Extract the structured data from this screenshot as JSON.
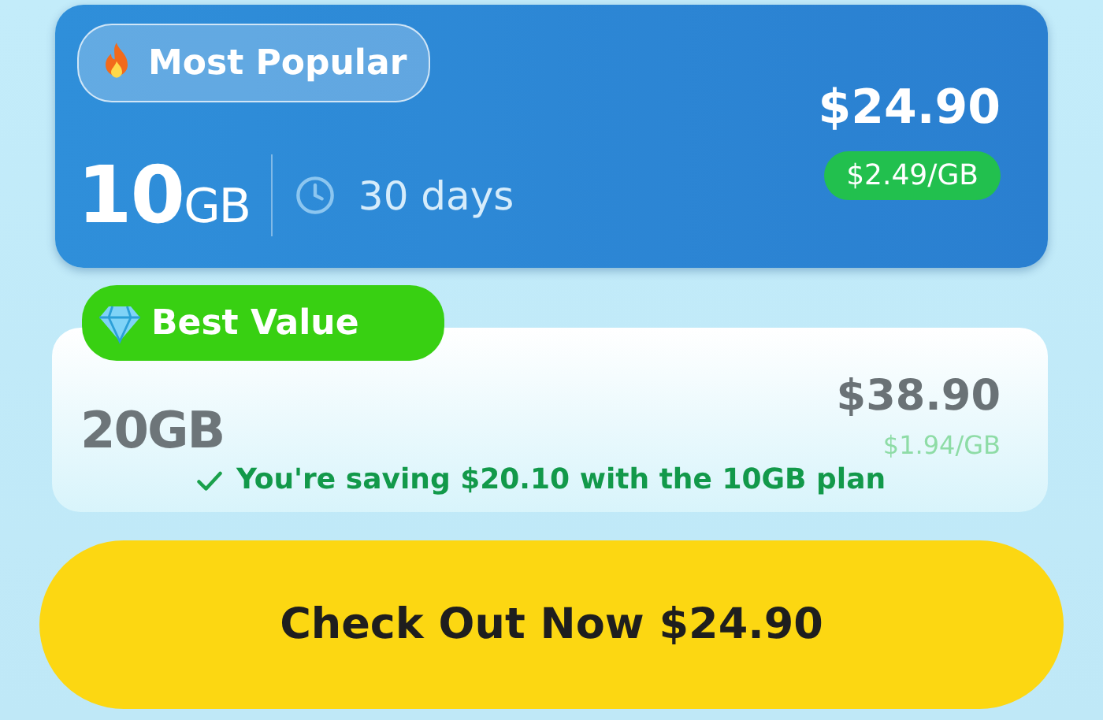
{
  "plans": [
    {
      "kind": "popular",
      "badge": "Most Popular",
      "data": "10",
      "unit": "GB",
      "duration": "30 days",
      "price": "$24.90",
      "per_gb": "$2.49/GB",
      "selected": true
    },
    {
      "kind": "value",
      "badge": "Best Value",
      "data": "20",
      "unit": "GB",
      "price": "$38.90",
      "per_gb": "$1.94/GB",
      "selected": false,
      "note": "You're saving $20.10 with the 10GB plan"
    }
  ],
  "checkout": {
    "label": "Check Out Now $24.90"
  }
}
